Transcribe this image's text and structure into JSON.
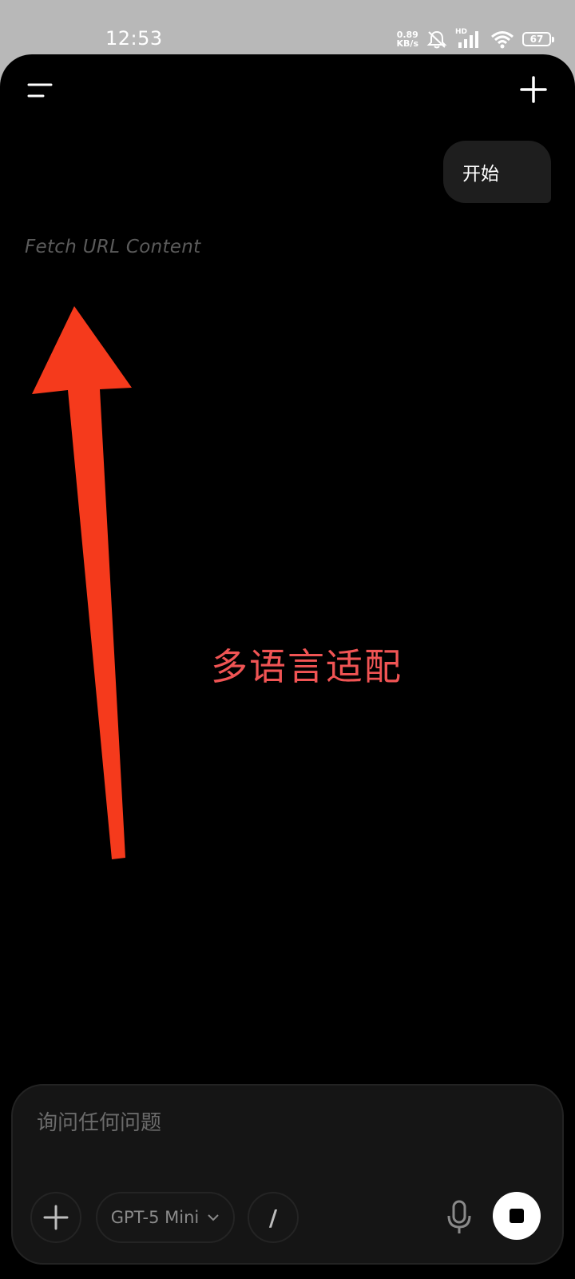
{
  "status_bar": {
    "time": "12:53",
    "net_speed_value": "0.89",
    "net_speed_unit": "KB/s",
    "hd_label": "HD",
    "battery": "67"
  },
  "conversation": {
    "user_message": "开始",
    "tool_status": "Fetch URL Content"
  },
  "annotation": {
    "text": "多语言适配",
    "color": "#f05454",
    "arrow_color": "#f53a1c"
  },
  "composer": {
    "placeholder": "询问任何问题",
    "value": "",
    "model_label": "GPT-5 Mini",
    "slash_label": "/"
  },
  "icons": {
    "menu": "menu-icon",
    "new_chat": "plus-icon",
    "attach": "plus-icon",
    "model_dropdown": "chevron-down-icon",
    "mic": "microphone-icon",
    "stop": "stop-icon"
  },
  "colors": {
    "background": "#000000",
    "bubble": "#1e1e1e",
    "composer": "#151515",
    "status_bar": "#b8b8b8"
  }
}
